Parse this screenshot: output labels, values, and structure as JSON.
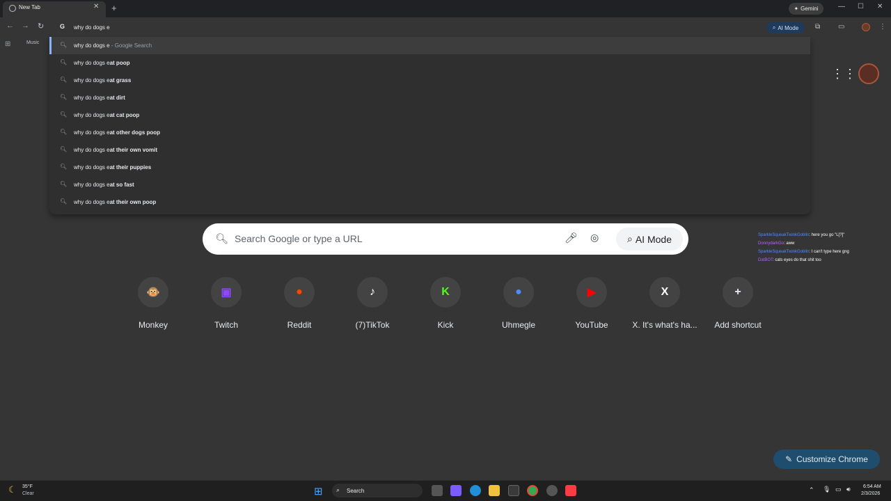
{
  "tab": {
    "title": "New Tab",
    "close_glyph": "✕"
  },
  "tabstrip": {
    "new_tab_glyph": "+",
    "gemini_label": "Gemini"
  },
  "window": {
    "minimize": "—",
    "maximize": "☐",
    "close": "✕"
  },
  "toolbar": {
    "back": "←",
    "forward": "→",
    "reload": "↻",
    "omnibox_text": "why do dogs e",
    "ai_mode_label": "AI Mode"
  },
  "bookmarks": {
    "music_label": "Music"
  },
  "dropdown": {
    "typed_prefix": "why do dogs e",
    "first_suffix": " - Google Search",
    "suggestions": [
      "at poop",
      "at grass",
      "at dirt",
      "at cat poop",
      "at other dogs poop",
      "at their own vomit",
      "at their puppies",
      "at so fast",
      "at their own poop"
    ]
  },
  "search": {
    "placeholder": "Search Google or type a URL",
    "ai_mode_label": "AI Mode"
  },
  "shortcuts": [
    {
      "label": "Monkey",
      "icon": "monkey-icon",
      "glyph": "🐵",
      "color": "#f5d0a0"
    },
    {
      "label": "Twitch",
      "icon": "twitch-icon",
      "glyph": "▣",
      "color": "#9146ff"
    },
    {
      "label": "Reddit",
      "icon": "reddit-icon",
      "glyph": "●",
      "color": "#ff4500"
    },
    {
      "label": "(7)TikTok",
      "icon": "tiktok-icon",
      "glyph": "♪",
      "color": "#ffffff"
    },
    {
      "label": "Kick",
      "icon": "kick-icon",
      "glyph": "K",
      "color": "#53fc18"
    },
    {
      "label": "Uhmegle",
      "icon": "uhmegle-icon",
      "glyph": "●",
      "color": "#4f8cff"
    },
    {
      "label": "YouTube",
      "icon": "youtube-icon",
      "glyph": "▶",
      "color": "#ff0000"
    },
    {
      "label": "X. It's what's ha...",
      "icon": "x-icon",
      "glyph": "X",
      "color": "#ffffff"
    },
    {
      "label": "Add shortcut",
      "icon": "plus-icon",
      "glyph": "+",
      "color": "#e8eaed"
    }
  ],
  "chat": [
    {
      "user": "SparkleSqueakTwinkGoblin",
      "message": ": here you go \"L[?]\"",
      "user_color": "#4f8cff"
    },
    {
      "user": "DonnydarkGo",
      "message": ": aww",
      "user_color": "#c060ff"
    },
    {
      "user": "SparkleSqueakTwinkGoblin",
      "message": ": I can't type here gng",
      "user_color": "#4f8cff"
    },
    {
      "user": "DatBOT",
      "message": ": cats eyes do that shit too",
      "user_color": "#b060ff"
    }
  ],
  "customize": {
    "label": "Customize Chrome"
  },
  "taskbar": {
    "weather_temp": "35°F",
    "weather_cond": "Clear",
    "search_label": "Search",
    "time": "6:54 AM",
    "date": "2/3/2026"
  }
}
